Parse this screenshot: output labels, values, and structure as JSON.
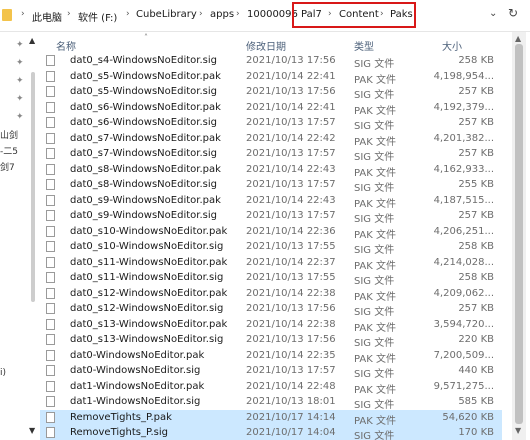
{
  "address": {
    "crumbs": [
      "此电脑",
      "软件 (F:)",
      "CubeLibrary",
      "apps",
      "10000096",
      "Pal7",
      "Content",
      "Paks"
    ],
    "separator": "›",
    "dropdown_icon": "chevron-down-icon",
    "refresh_icon": "refresh-icon",
    "highlight_color": "#d81818"
  },
  "nav": {
    "labels": [
      "山剑",
      "-二5",
      "剑7",
      "i)"
    ]
  },
  "columns": {
    "name": "名称",
    "date": "修改日期",
    "type": "类型",
    "size": "大小"
  },
  "files": [
    {
      "name": "dat0_s4-WindowsNoEditor.sig",
      "date": "2021/10/13 17:56",
      "type": "SIG 文件",
      "size": "258 KB"
    },
    {
      "name": "dat0_s5-WindowsNoEditor.pak",
      "date": "2021/10/14 22:41",
      "type": "PAK 文件",
      "size": "4,198,954..."
    },
    {
      "name": "dat0_s5-WindowsNoEditor.sig",
      "date": "2021/10/13 17:56",
      "type": "SIG 文件",
      "size": "257 KB"
    },
    {
      "name": "dat0_s6-WindowsNoEditor.pak",
      "date": "2021/10/14 22:41",
      "type": "PAK 文件",
      "size": "4,192,379..."
    },
    {
      "name": "dat0_s6-WindowsNoEditor.sig",
      "date": "2021/10/13 17:57",
      "type": "SIG 文件",
      "size": "257 KB"
    },
    {
      "name": "dat0_s7-WindowsNoEditor.pak",
      "date": "2021/10/14 22:42",
      "type": "PAK 文件",
      "size": "4,201,382..."
    },
    {
      "name": "dat0_s7-WindowsNoEditor.sig",
      "date": "2021/10/13 17:57",
      "type": "SIG 文件",
      "size": "257 KB"
    },
    {
      "name": "dat0_s8-WindowsNoEditor.pak",
      "date": "2021/10/14 22:43",
      "type": "PAK 文件",
      "size": "4,162,933..."
    },
    {
      "name": "dat0_s8-WindowsNoEditor.sig",
      "date": "2021/10/13 17:57",
      "type": "SIG 文件",
      "size": "255 KB"
    },
    {
      "name": "dat0_s9-WindowsNoEditor.pak",
      "date": "2021/10/14 22:43",
      "type": "PAK 文件",
      "size": "4,187,515..."
    },
    {
      "name": "dat0_s9-WindowsNoEditor.sig",
      "date": "2021/10/13 17:57",
      "type": "SIG 文件",
      "size": "257 KB"
    },
    {
      "name": "dat0_s10-WindowsNoEditor.pak",
      "date": "2021/10/14 22:36",
      "type": "PAK 文件",
      "size": "4,206,251..."
    },
    {
      "name": "dat0_s10-WindowsNoEditor.sig",
      "date": "2021/10/13 17:55",
      "type": "SIG 文件",
      "size": "258 KB"
    },
    {
      "name": "dat0_s11-WindowsNoEditor.pak",
      "date": "2021/10/14 22:37",
      "type": "PAK 文件",
      "size": "4,214,028..."
    },
    {
      "name": "dat0_s11-WindowsNoEditor.sig",
      "date": "2021/10/13 17:55",
      "type": "SIG 文件",
      "size": "258 KB"
    },
    {
      "name": "dat0_s12-WindowsNoEditor.pak",
      "date": "2021/10/14 22:38",
      "type": "PAK 文件",
      "size": "4,209,062..."
    },
    {
      "name": "dat0_s12-WindowsNoEditor.sig",
      "date": "2021/10/13 17:56",
      "type": "SIG 文件",
      "size": "257 KB"
    },
    {
      "name": "dat0_s13-WindowsNoEditor.pak",
      "date": "2021/10/14 22:38",
      "type": "PAK 文件",
      "size": "3,594,720..."
    },
    {
      "name": "dat0_s13-WindowsNoEditor.sig",
      "date": "2021/10/13 17:56",
      "type": "SIG 文件",
      "size": "220 KB"
    },
    {
      "name": "dat0-WindowsNoEditor.pak",
      "date": "2021/10/14 22:35",
      "type": "PAK 文件",
      "size": "7,200,509..."
    },
    {
      "name": "dat0-WindowsNoEditor.sig",
      "date": "2021/10/13 17:57",
      "type": "SIG 文件",
      "size": "440 KB"
    },
    {
      "name": "dat1-WindowsNoEditor.pak",
      "date": "2021/10/14 22:48",
      "type": "PAK 文件",
      "size": "9,571,275..."
    },
    {
      "name": "dat1-WindowsNoEditor.sig",
      "date": "2021/10/13 18:01",
      "type": "SIG 文件",
      "size": "585 KB"
    },
    {
      "name": "RemoveTights_P.pak",
      "date": "2021/10/17 14:14",
      "type": "PAK 文件",
      "size": "54,620 KB",
      "selected": true
    },
    {
      "name": "RemoveTights_P.sig",
      "date": "2021/10/17 14:04",
      "type": "SIG 文件",
      "size": "170 KB",
      "selected": true
    }
  ]
}
